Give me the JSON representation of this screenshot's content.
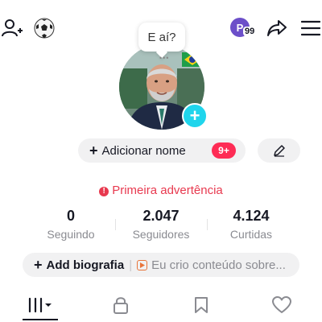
{
  "header": {
    "icons": [
      "add-friend-icon",
      "soccer-ball-icon",
      "profile-switch-icon",
      "share-icon",
      "menu-icon"
    ],
    "profile_badge_count": "99"
  },
  "bubble": {
    "text": "E aí?"
  },
  "profile": {
    "add_name_label": "Adicionar nome",
    "notification_badge": "9+",
    "warning": "Primeira advertência"
  },
  "stats": [
    {
      "value": "0",
      "label": "Seguindo"
    },
    {
      "value": "2.047",
      "label": "Seguidores"
    },
    {
      "value": "4.124",
      "label": "Curtidas"
    }
  ],
  "bio": {
    "add_label": "Add biografia",
    "placeholder": "Eu crio conteúdo sobre..."
  },
  "tabs": [
    {
      "name": "videos-grid-tab",
      "icon": "grid-icon",
      "active": true
    },
    {
      "name": "private-tab",
      "icon": "lock-icon",
      "active": false
    },
    {
      "name": "saved-tab",
      "icon": "bookmark-icon",
      "active": false
    },
    {
      "name": "liked-tab",
      "icon": "heart-icon",
      "active": false
    }
  ],
  "colors": {
    "accent_red": "#fe2c55",
    "warning_red": "#e8394f",
    "cyan": "#20d5ec",
    "pill_gray": "#f1f1f2"
  }
}
